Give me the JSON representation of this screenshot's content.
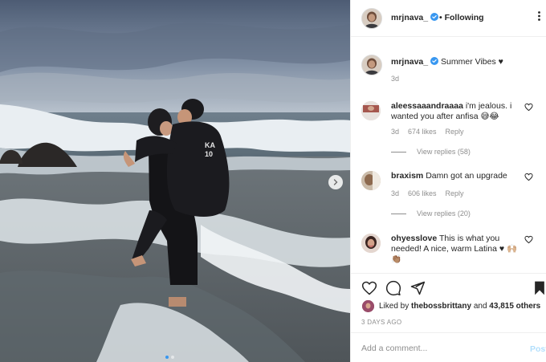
{
  "post": {
    "username": "mrjnava_",
    "follow_dot": "•",
    "follow_label": "Following",
    "more_icon": "more-horizontal-icon",
    "caption_text": "Summer Vibes ♥",
    "caption_time": "3d"
  },
  "comments": [
    {
      "username": "aleessaaandraaaa",
      "text": "i'm jealous. i wanted you after anfisa 😅😂",
      "time": "3d",
      "likes": "674 likes",
      "reply_label": "Reply",
      "view_replies": "View replies (58)"
    },
    {
      "username": "braxism",
      "text": "Damn got an upgrade",
      "time": "3d",
      "likes": "606 likes",
      "reply_label": "Reply",
      "view_replies": "View replies (20)"
    },
    {
      "username": "ohyesslove",
      "text": "This is what you needed! A nice, warm Latina ♥ 🙌🏼👏🏽"
    }
  ],
  "likes": {
    "prefix": "Liked by",
    "user": "thebossbrittany",
    "connector": "and",
    "others": "43,815 others"
  },
  "post_date": "3 DAYS AGO",
  "add_comment": {
    "placeholder": "Add a comment...",
    "post_label": "Post"
  },
  "carousel": {
    "slide_count": 2,
    "active_index": 0
  },
  "colors": {
    "verified": "#3897f0",
    "post_button_disabled": "#b2dffc",
    "muted_text": "#8e8e8e",
    "border": "#efefef"
  }
}
